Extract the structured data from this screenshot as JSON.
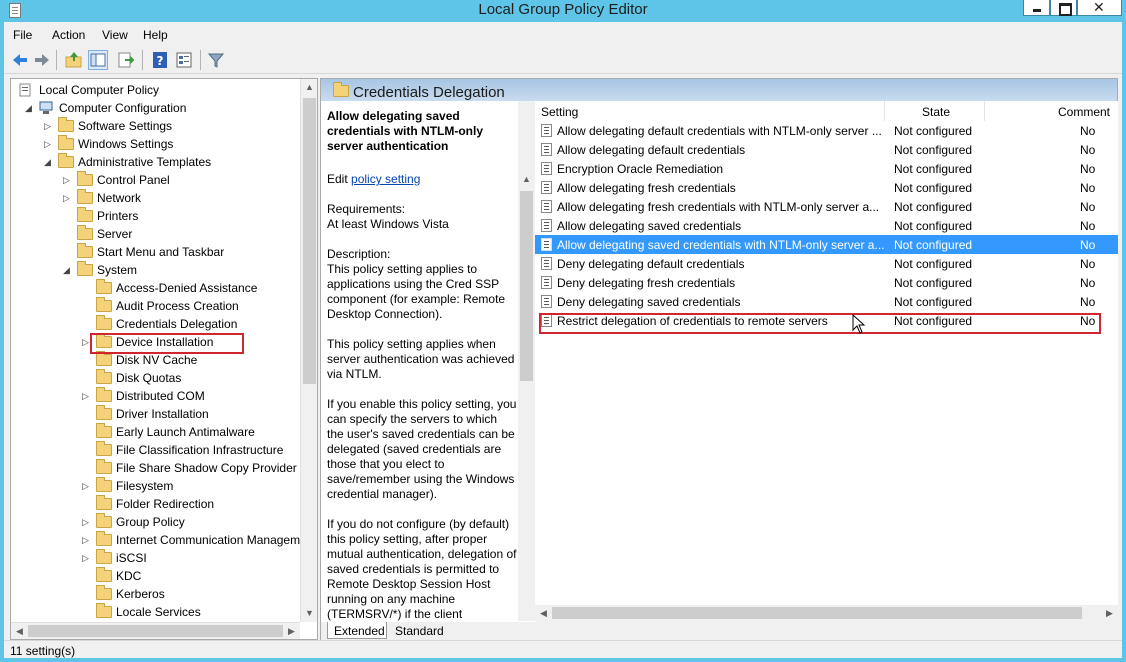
{
  "window": {
    "title": "Local Group Policy Editor"
  },
  "menu": [
    "File",
    "Action",
    "View",
    "Help"
  ],
  "toolbar_icons": [
    "back-arrow-icon",
    "forward-arrow-icon",
    "up-folder-icon",
    "show-hide-tree-icon",
    "export-list-icon",
    "help-icon",
    "properties-icon",
    "filter-icon"
  ],
  "tree": {
    "items": [
      {
        "label": "Local Computer Policy",
        "level": 0,
        "expander": "",
        "icon": "policy-doc-icon"
      },
      {
        "label": "Computer Configuration",
        "level": 1,
        "expander": "expanded",
        "icon": "computer-icon"
      },
      {
        "label": "Software Settings",
        "level": 2,
        "expander": "collapsed",
        "icon": "folder-icon"
      },
      {
        "label": "Windows Settings",
        "level": 2,
        "expander": "collapsed",
        "icon": "folder-icon"
      },
      {
        "label": "Administrative Templates",
        "level": 2,
        "expander": "expanded",
        "icon": "folder-icon"
      },
      {
        "label": "Control Panel",
        "level": 3,
        "expander": "collapsed",
        "icon": "folder-icon"
      },
      {
        "label": "Network",
        "level": 3,
        "expander": "collapsed",
        "icon": "folder-icon"
      },
      {
        "label": "Printers",
        "level": 3,
        "expander": "",
        "icon": "folder-icon"
      },
      {
        "label": "Server",
        "level": 3,
        "expander": "",
        "icon": "folder-icon"
      },
      {
        "label": "Start Menu and Taskbar",
        "level": 3,
        "expander": "",
        "icon": "folder-icon"
      },
      {
        "label": "System",
        "level": 3,
        "expander": "expanded",
        "icon": "folder-icon"
      },
      {
        "label": "Access-Denied Assistance",
        "level": 4,
        "expander": "",
        "icon": "folder-icon"
      },
      {
        "label": "Audit Process Creation",
        "level": 4,
        "expander": "",
        "icon": "folder-icon"
      },
      {
        "label": "Credentials Delegation",
        "level": 4,
        "expander": "",
        "icon": "folder-icon",
        "selected": true
      },
      {
        "label": "Device Installation",
        "level": 4,
        "expander": "collapsed",
        "icon": "folder-icon"
      },
      {
        "label": "Disk NV Cache",
        "level": 4,
        "expander": "",
        "icon": "folder-icon"
      },
      {
        "label": "Disk Quotas",
        "level": 4,
        "expander": "",
        "icon": "folder-icon"
      },
      {
        "label": "Distributed COM",
        "level": 4,
        "expander": "collapsed",
        "icon": "folder-icon"
      },
      {
        "label": "Driver Installation",
        "level": 4,
        "expander": "",
        "icon": "folder-icon"
      },
      {
        "label": "Early Launch Antimalware",
        "level": 4,
        "expander": "",
        "icon": "folder-icon"
      },
      {
        "label": "File Classification Infrastructure",
        "level": 4,
        "expander": "",
        "icon": "folder-icon"
      },
      {
        "label": "File Share Shadow Copy Provider",
        "level": 4,
        "expander": "",
        "icon": "folder-icon"
      },
      {
        "label": "Filesystem",
        "level": 4,
        "expander": "collapsed",
        "icon": "folder-icon"
      },
      {
        "label": "Folder Redirection",
        "level": 4,
        "expander": "",
        "icon": "folder-icon"
      },
      {
        "label": "Group Policy",
        "level": 4,
        "expander": "collapsed",
        "icon": "folder-icon"
      },
      {
        "label": "Internet Communication Managem",
        "level": 4,
        "expander": "collapsed",
        "icon": "folder-icon"
      },
      {
        "label": "iSCSI",
        "level": 4,
        "expander": "collapsed",
        "icon": "folder-icon"
      },
      {
        "label": "KDC",
        "level": 4,
        "expander": "",
        "icon": "folder-icon"
      },
      {
        "label": "Kerberos",
        "level": 4,
        "expander": "",
        "icon": "folder-icon"
      },
      {
        "label": "Locale Services",
        "level": 4,
        "expander": "",
        "icon": "folder-icon"
      }
    ]
  },
  "details": {
    "header": "Credentials Delegation",
    "description": {
      "title": "Allow delegating saved credentials with NTLM-only server authentication",
      "edit_prefix": "Edit ",
      "edit_link": "policy setting ",
      "requirements_label": "Requirements:",
      "requirements_value": "At least Windows Vista",
      "description_label": "Description:",
      "paragraphs": [
        "This policy setting applies to applications using the Cred SSP component (for example: Remote Desktop Connection).",
        "This policy setting applies when server authentication was achieved via NTLM.",
        "If you enable this policy setting, you can specify the servers to which the user's saved credentials can be delegated (saved credentials are those that you elect to save/remember using the Windows credential manager).",
        "If you do not configure (by default) this policy setting, after proper mutual authentication, delegation of saved credentials is permitted to Remote Desktop Session Host running on any machine (TERMSRV/*) if the client"
      ]
    },
    "columns": {
      "setting": "Setting",
      "state": "State",
      "comment": "Comment"
    },
    "rows": [
      {
        "setting": "Allow delegating default credentials with NTLM-only server ...",
        "state": "Not configured",
        "comment": "No"
      },
      {
        "setting": "Allow delegating default credentials",
        "state": "Not configured",
        "comment": "No"
      },
      {
        "setting": "Encryption Oracle Remediation",
        "state": "Not configured",
        "comment": "No"
      },
      {
        "setting": "Allow delegating fresh credentials",
        "state": "Not configured",
        "comment": "No"
      },
      {
        "setting": "Allow delegating fresh credentials with NTLM-only server a...",
        "state": "Not configured",
        "comment": "No"
      },
      {
        "setting": "Allow delegating saved credentials",
        "state": "Not configured",
        "comment": "No"
      },
      {
        "setting": "Allow delegating saved credentials with NTLM-only server a...",
        "state": "Not configured",
        "comment": "No",
        "selected": true
      },
      {
        "setting": "Deny delegating default credentials",
        "state": "Not configured",
        "comment": "No"
      },
      {
        "setting": "Deny delegating fresh credentials",
        "state": "Not configured",
        "comment": "No"
      },
      {
        "setting": "Deny delegating saved credentials",
        "state": "Not configured",
        "comment": "No"
      },
      {
        "setting": "Restrict delegation of credentials to remote servers",
        "state": "Not configured",
        "comment": "No"
      }
    ],
    "tabs": [
      "Extended",
      "Standard"
    ]
  },
  "status": {
    "text": "11 setting(s)"
  },
  "colors": {
    "titlebar": "#5ec4e8",
    "selection": "#3399ff",
    "highlight_box": "#d2262f",
    "header_gradient": "#a7c5e4"
  }
}
